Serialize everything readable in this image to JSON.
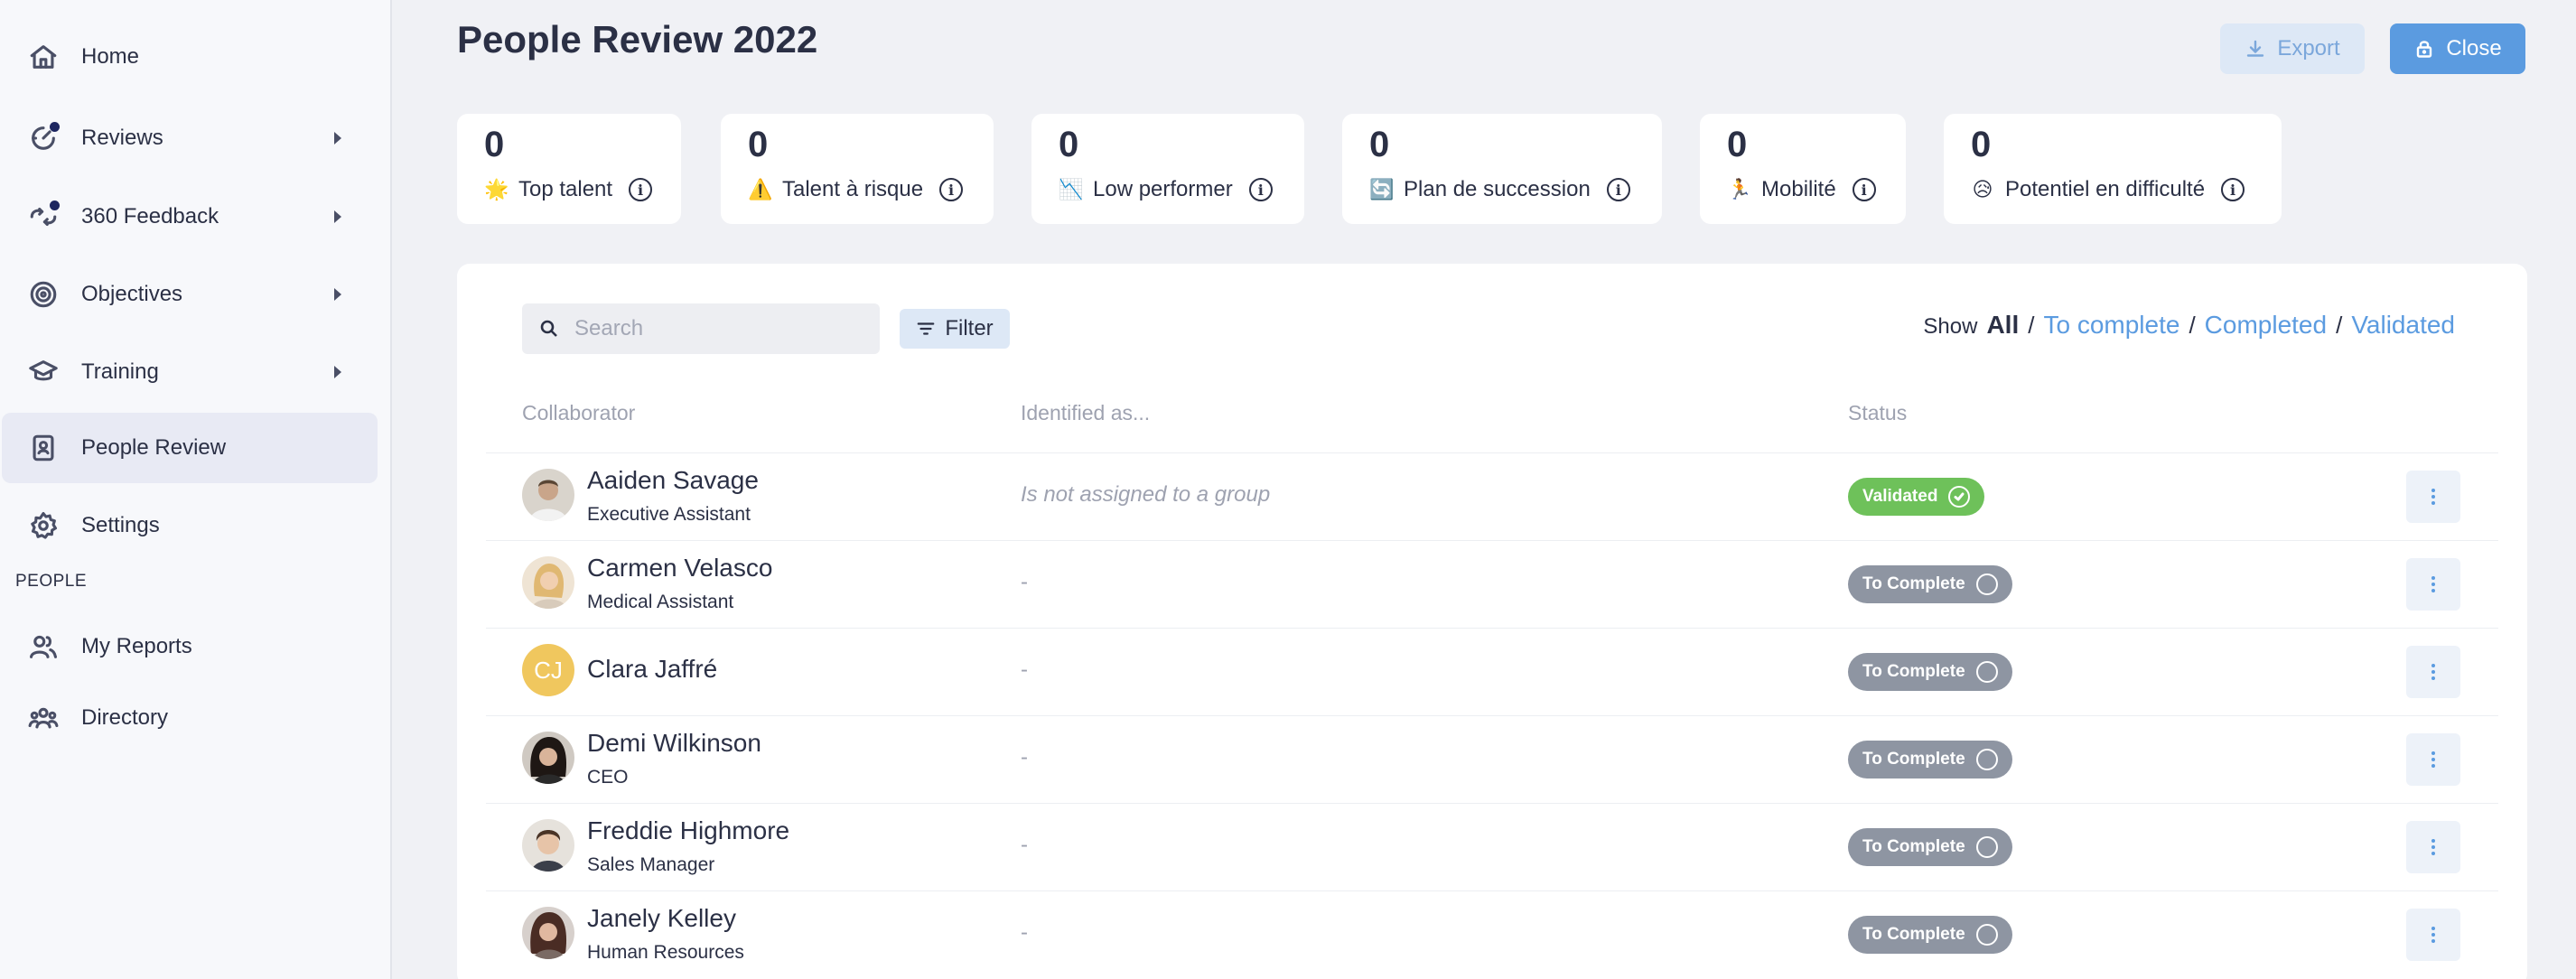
{
  "sidebar": {
    "items": [
      {
        "label": "Home",
        "icon": "home-icon",
        "caret": false,
        "dot": false,
        "active": false
      },
      {
        "label": "Reviews",
        "icon": "gauge-icon",
        "caret": true,
        "dot": true,
        "active": false
      },
      {
        "label": "360 Feedback",
        "icon": "feedback-icon",
        "caret": true,
        "dot": true,
        "active": false
      },
      {
        "label": "Objectives",
        "icon": "target-icon",
        "caret": true,
        "dot": false,
        "active": false
      },
      {
        "label": "Training",
        "icon": "graduation-cap-icon",
        "caret": true,
        "dot": false,
        "active": false
      },
      {
        "label": "People Review",
        "icon": "id-badge-icon",
        "caret": false,
        "dot": false,
        "active": true
      },
      {
        "label": "Settings",
        "icon": "gear-icon",
        "caret": false,
        "dot": false,
        "active": false
      }
    ],
    "section_title": "PEOPLE",
    "people_items": [
      {
        "label": "My Reports",
        "icon": "users-icon"
      },
      {
        "label": "Directory",
        "icon": "team-icon"
      }
    ]
  },
  "header": {
    "title": "People Review 2022",
    "export_label": "Export",
    "close_label": "Close"
  },
  "stats": [
    {
      "value": "0",
      "label": "Top talent",
      "emoji": "🌟"
    },
    {
      "value": "0",
      "label": "Talent à risque",
      "emoji": "⚠️"
    },
    {
      "value": "0",
      "label": "Low performer",
      "emoji": "📉"
    },
    {
      "value": "0",
      "label": "Plan de succession",
      "emoji": "🔄"
    },
    {
      "value": "0",
      "label": "Mobilité",
      "emoji": "🏃"
    },
    {
      "value": "0",
      "label": "Potentiel en difficulté",
      "emoji": "😥"
    }
  ],
  "toolbar": {
    "search_placeholder": "Search",
    "filter_label": "Filter",
    "show_label": "Show",
    "show_all": "All",
    "show_to_complete": "To complete",
    "show_completed": "Completed",
    "show_validated": "Validated",
    "sep": "/"
  },
  "table": {
    "columns": [
      "Collaborator",
      "Identified as...",
      "Status"
    ],
    "rows": [
      {
        "name": "Aaiden Savage",
        "role": "Executive Assistant",
        "identified": "Is not assigned to a group",
        "status": "Validated",
        "status_color": "#6ec15a",
        "avatar_color": "#8a6f5a"
      },
      {
        "name": "Carmen Velasco",
        "role": "Medical Assistant",
        "identified": "-",
        "status": "To Complete",
        "status_color": "#8e95a2",
        "avatar_color": "#e3c48c"
      },
      {
        "name": "Clara Jaffré",
        "role": "",
        "identified": "-",
        "status": "To Complete",
        "status_color": "#8e95a2",
        "avatar_initials": "CJ",
        "avatar_color": "#f0c75e"
      },
      {
        "name": "Demi Wilkinson",
        "role": "CEO",
        "identified": "-",
        "status": "To Complete",
        "status_color": "#8e95a2",
        "avatar_color": "#3a2a22"
      },
      {
        "name": "Freddie Highmore",
        "role": "Sales Manager",
        "identified": "-",
        "status": "To Complete",
        "status_color": "#8e95a2",
        "avatar_color": "#6b5240"
      },
      {
        "name": "Janely Kelley",
        "role": "Human Resources",
        "identified": "-",
        "status": "To Complete",
        "status_color": "#8e95a2",
        "avatar_color": "#5a3a30"
      }
    ]
  }
}
